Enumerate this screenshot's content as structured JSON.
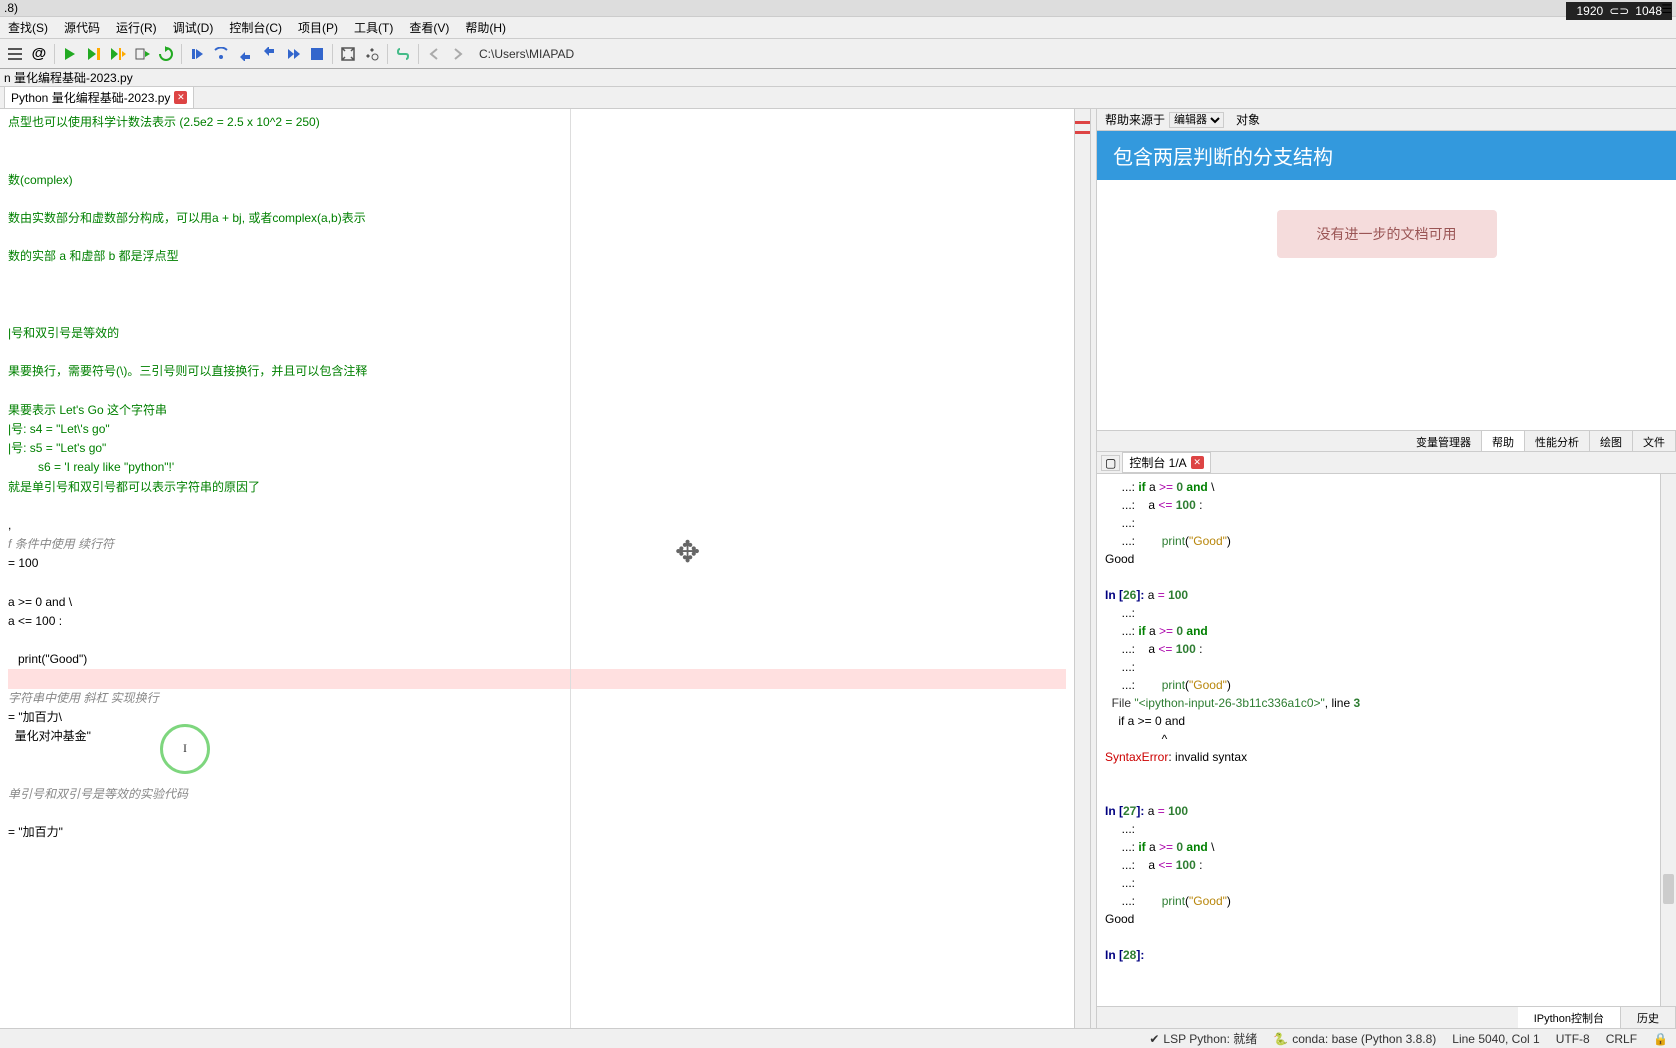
{
  "titlebar": ".8)",
  "resolution_badge": {
    "w": "1920",
    "link": "⊂⊃",
    "h": "1048"
  },
  "menu": {
    "search": "查找(S)",
    "source": "源代码",
    "run": "运行(R)",
    "debug": "调试(D)",
    "console": "控制台(C)",
    "project": "项目(P)",
    "tools": "工具(T)",
    "view": "查看(V)",
    "help": "帮助(H)"
  },
  "toolbar_path": "C:\\Users\\MIAPAD",
  "breadcrumb": "n  量化编程基础-2023.py",
  "editor_tab": "Python  量化编程基础-2023.py",
  "code": {
    "l1": "点型也可以使用科学计数法表示 (2.5e2 = 2.5 x 10^2 = 250)",
    "l2": "数(complex)",
    "l3": "数由实数部分和虚数部分构成，可以用a + bj, 或者complex(a,b)表示",
    "l4": "数的实部 a 和虚部 b 都是浮点型",
    "l5": "|号和双引号是等效的",
    "l6": "果要换行，需要符号(\\)。三引号则可以直接换行，并且可以包含注释",
    "l7": "果要表示 Let's Go 这个字符串",
    "l8": "|号: s4 = \"Let\\'s go\"",
    "l9": "|号: s5 = \"Let's go\"",
    "l10": "         s6 = 'I realy like \"python\"!'",
    "l11": "就是单引号和双引号都可以表示字符串的原因了",
    "l12": "f 条件中使用 续行符",
    "l13": "= 100",
    "l14": "a >= 0 and \\",
    "l15": "a <= 100 :",
    "l16": "   print(\"Good\")",
    "l17": "字符串中使用 斜杠 实现换行",
    "l18": "= \"加百力\\",
    "l19": "  量化对冲基金\"",
    "l20": "单引号和双引号是等效的实验代码",
    "l21": "= \"加百力\""
  },
  "help": {
    "source_label": "帮助来源于",
    "source_value": "编辑器",
    "object_label": "对象",
    "title": "包含两层判断的分支结构",
    "no_doc": "没有进一步的文档可用",
    "tabs": {
      "var": "变量管理器",
      "help": "帮助",
      "perf": "性能分析",
      "plot": "绘图",
      "file": "文件"
    }
  },
  "console": {
    "tab_label": "控制台 1/A",
    "bottom": {
      "ipython": "IPython控制台",
      "history": "历史"
    }
  },
  "statusbar": {
    "lsp": "LSP Python: 就绪",
    "conda": "conda: base (Python 3.8.8)",
    "line": "Line 5040, Col 1",
    "enc": "UTF-8",
    "eol": "CRLF"
  }
}
